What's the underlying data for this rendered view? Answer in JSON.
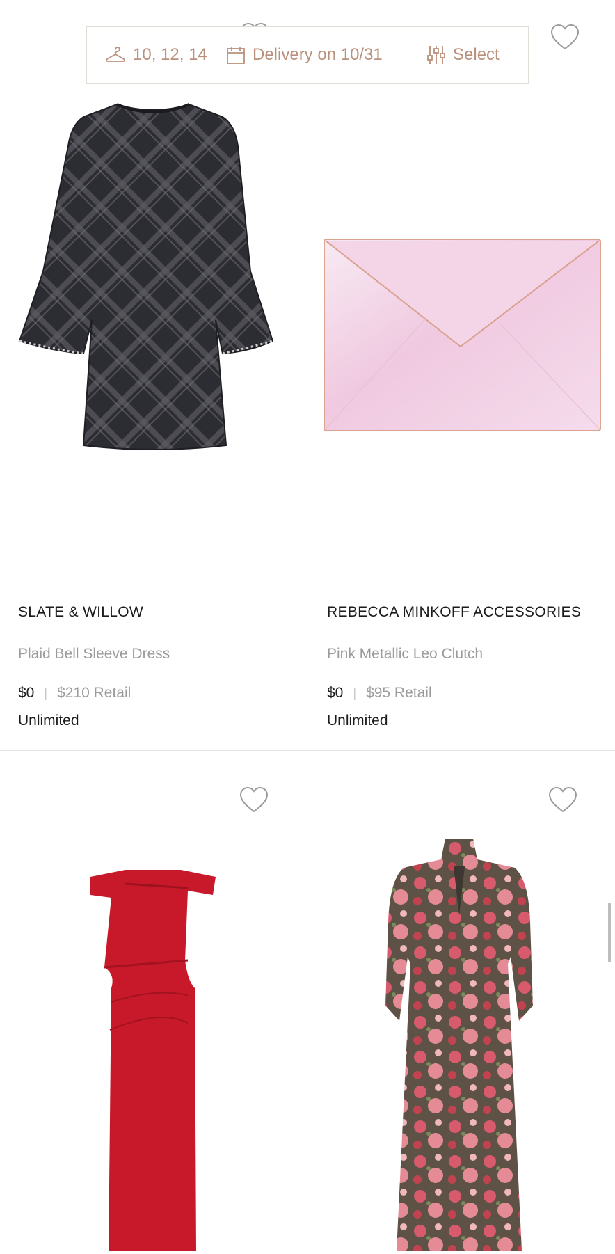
{
  "filters": {
    "sizes": "10, 12, 14",
    "delivery": "Delivery on 10/31",
    "select": "Select"
  },
  "products": [
    {
      "brand": "SLATE & WILLOW",
      "name": "Plaid Bell Sleeve Dress",
      "price": "$0",
      "retail": "$210 Retail",
      "plan": "Unlimited"
    },
    {
      "brand": "REBECCA MINKOFF ACCESSORIES",
      "name": "Pink Metallic Leo Clutch",
      "price": "$0",
      "retail": "$95 Retail",
      "plan": "Unlimited"
    },
    {
      "image": "red-off-shoulder-gown"
    },
    {
      "image": "floral-long-sleeve-gown"
    }
  ],
  "colors": {
    "accent": "#b9907b",
    "divider": "#e3e3e3",
    "muted_text": "#9b9b9b"
  }
}
